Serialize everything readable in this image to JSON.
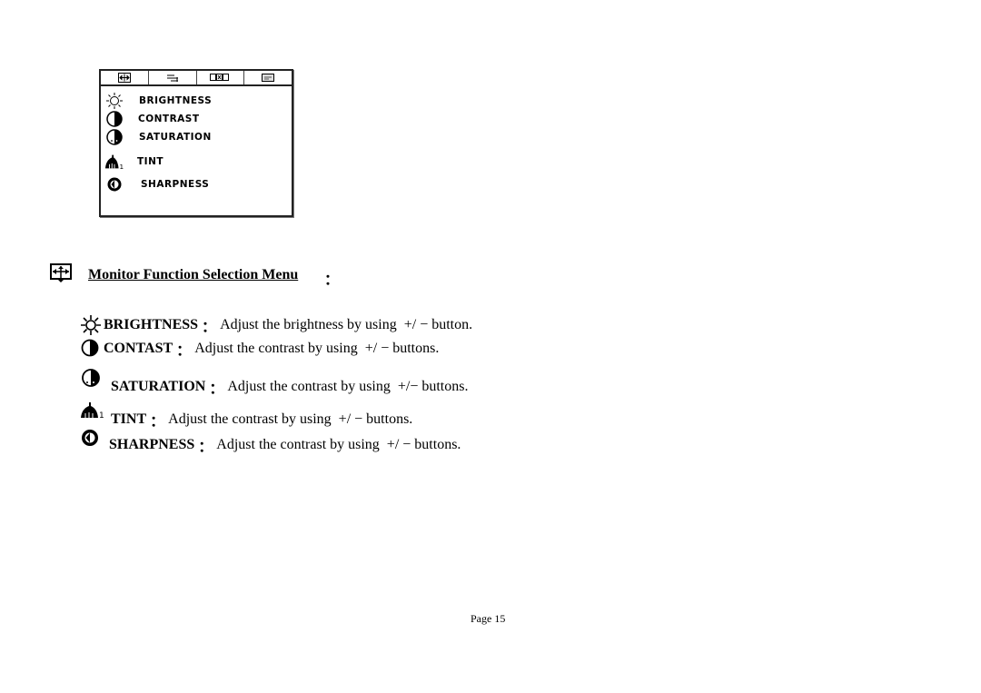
{
  "osd": {
    "tabs": [
      {
        "icon": "position-arrows-icon"
      },
      {
        "icon": "adjust-lines-icon"
      },
      {
        "icon": "monitors-icon"
      },
      {
        "icon": "screen-icon"
      }
    ],
    "items": [
      {
        "label": "BRIGHTNESS",
        "icon": "sun-icon"
      },
      {
        "label": "CONTRAST",
        "icon": "half-circle-icon"
      },
      {
        "label": "SATURATION",
        "icon": "saturation-icon"
      },
      {
        "label": "TINT",
        "icon": "tint-icon",
        "suffix": "1"
      },
      {
        "label": "SHARPNESS",
        "icon": "sharpness-icon"
      }
    ]
  },
  "section": {
    "title": "Monitor Function Selection Menu",
    "colon": "："
  },
  "descriptions": [
    {
      "name": "BRIGHTNESS",
      "sep": "：",
      "text": "Adjust the brightness by using  +/ − button."
    },
    {
      "name": "CONTAST",
      "sep": "：",
      "text": "Adjust the contrast by using  +/ − buttons."
    },
    {
      "name": "SATURATION",
      "sep": "：",
      "text": "Adjust the contrast by using  +/− buttons."
    },
    {
      "name": "TINT",
      "sep": "：",
      "text": "Adjust the contrast by using  +/ − buttons."
    },
    {
      "name": "SHARPNESS",
      "sep": "：",
      "text": "Adjust the contrast by using  +/ − buttons."
    }
  ],
  "tint_suffix": "1",
  "footer": {
    "page": "Page 15"
  }
}
